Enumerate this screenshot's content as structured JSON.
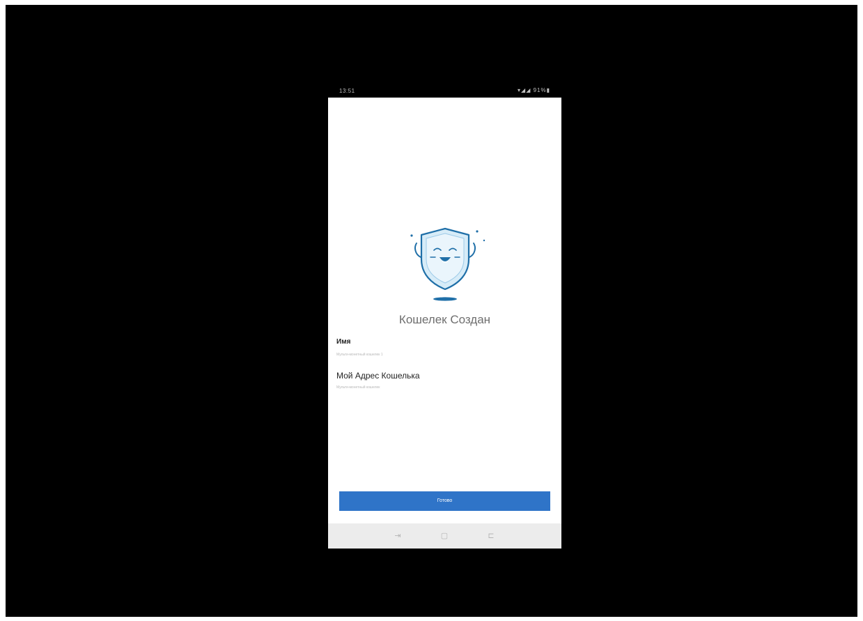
{
  "status_bar": {
    "time": "13:51",
    "icons": "▾◢◢ 91%▮"
  },
  "screen": {
    "illustration_icon": "smiling-shield-icon",
    "title": "Кошелек Создан",
    "fields": [
      {
        "label": "Имя",
        "value": "Мульти-монетный кошелек 1"
      },
      {
        "label": "Мой Адрес Кошелька",
        "value": "Мульти-монетный кошелек"
      }
    ],
    "done_button_label": "Готово"
  },
  "nav_bar": {
    "back_icon": "back-icon",
    "home_icon": "home-icon",
    "recents_icon": "recents-icon"
  },
  "colors": {
    "accent": "#2f74c8",
    "shield_fill": "#d7ecf8",
    "shield_stroke": "#1f6fa8",
    "background": "#000000"
  }
}
